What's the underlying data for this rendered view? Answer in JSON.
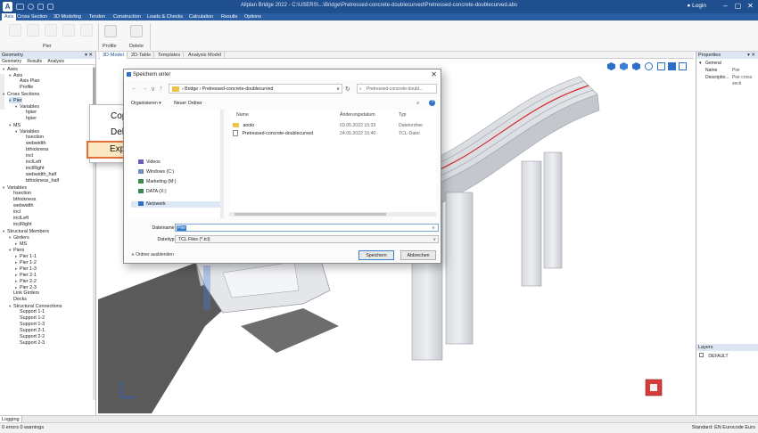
{
  "app": {
    "logo_text": "A",
    "window_title": "Allplan Bridge 2022 - C:\\USERS\\...\\Bridge\\Pretressed-concrete-doublecurved\\Pretressed-concrete-doublecurved.abs",
    "login_label": "Login",
    "window_buttons": [
      "–",
      "▢",
      "✕"
    ]
  },
  "menubar": {
    "items": [
      "Axis",
      "Cross Section",
      "3D Modeling",
      "Tendon",
      "Construction",
      "Loads & Checks",
      "Calculation",
      "Results",
      "Options"
    ],
    "active_index": 0
  },
  "ribbon": {
    "groups": [
      {
        "label": "Pier"
      },
      {
        "label": "Profile"
      },
      {
        "label": "Delete"
      }
    ]
  },
  "left_panel": {
    "title": "Geometry",
    "tabs": [
      "Geometry",
      "Results",
      "Analysis"
    ],
    "tree": [
      {
        "label": "Axes",
        "level": 0,
        "arrow": "▾"
      },
      {
        "label": "Axis",
        "level": 1,
        "arrow": "▾"
      },
      {
        "label": "Axis Plan",
        "level": 2,
        "arrow": ""
      },
      {
        "label": "Profile",
        "level": 2,
        "arrow": ""
      },
      {
        "label": "Cross Sections",
        "level": 0,
        "arrow": "▾"
      },
      {
        "label": "Pier",
        "level": 1,
        "arrow": "▾",
        "selected": true
      },
      {
        "label": "Variables",
        "level": 2,
        "arrow": "▾"
      },
      {
        "label": "hpier",
        "level": 3,
        "arrow": ""
      },
      {
        "label": "hpier",
        "level": 3,
        "arrow": ""
      },
      {
        "label": "MS",
        "level": 1,
        "arrow": "▾"
      },
      {
        "label": "Variables",
        "level": 2,
        "arrow": "▾"
      },
      {
        "label": "hsection",
        "level": 3,
        "arrow": ""
      },
      {
        "label": "webwidth",
        "level": 3,
        "arrow": ""
      },
      {
        "label": "bthickness",
        "level": 3,
        "arrow": ""
      },
      {
        "label": "incl",
        "level": 3,
        "arrow": ""
      },
      {
        "label": "inclLeft",
        "level": 3,
        "arrow": ""
      },
      {
        "label": "inclRight",
        "level": 3,
        "arrow": ""
      },
      {
        "label": "webwidth_half",
        "level": 3,
        "arrow": ""
      },
      {
        "label": "bthickness_half",
        "level": 3,
        "arrow": ""
      },
      {
        "label": "Variables",
        "level": 0,
        "arrow": "▾"
      },
      {
        "label": "hsection",
        "level": 1,
        "arrow": ""
      },
      {
        "label": "bthickness",
        "level": 1,
        "arrow": ""
      },
      {
        "label": "webwidth",
        "level": 1,
        "arrow": ""
      },
      {
        "label": "incl",
        "level": 1,
        "arrow": ""
      },
      {
        "label": "inclLeft",
        "level": 1,
        "arrow": ""
      },
      {
        "label": "inclRight",
        "level": 1,
        "arrow": ""
      },
      {
        "label": "Structural Members",
        "level": 0,
        "arrow": "▾"
      },
      {
        "label": "Girders",
        "level": 1,
        "arrow": "▾"
      },
      {
        "label": "MS",
        "level": 2,
        "arrow": "▸"
      },
      {
        "label": "Piers",
        "level": 1,
        "arrow": "▾"
      },
      {
        "label": "Pier 1-1",
        "level": 2,
        "arrow": "▸"
      },
      {
        "label": "Pier 1-2",
        "level": 2,
        "arrow": "▸"
      },
      {
        "label": "Pier 1-3",
        "level": 2,
        "arrow": "▸"
      },
      {
        "label": "Pier 2-1",
        "level": 2,
        "arrow": "▸"
      },
      {
        "label": "Pier 2-2",
        "level": 2,
        "arrow": "▸"
      },
      {
        "label": "Pier 2-3",
        "level": 2,
        "arrow": "▸"
      },
      {
        "label": "Link Girders",
        "level": 1,
        "arrow": ""
      },
      {
        "label": "Decks",
        "level": 1,
        "arrow": ""
      },
      {
        "label": "Structural Connections",
        "level": 1,
        "arrow": "▾"
      },
      {
        "label": "Support 1-1",
        "level": 2,
        "arrow": ""
      },
      {
        "label": "Support 1-2",
        "level": 2,
        "arrow": ""
      },
      {
        "label": "Support 1-3",
        "level": 2,
        "arrow": ""
      },
      {
        "label": "Support 2-1",
        "level": 2,
        "arrow": ""
      },
      {
        "label": "Support 2-2",
        "level": 2,
        "arrow": ""
      },
      {
        "label": "Support 2-3",
        "level": 2,
        "arrow": ""
      }
    ]
  },
  "center": {
    "tabs": [
      "3D-Model",
      "2D-Table",
      "Templates",
      "Analysis Model"
    ],
    "active_tab": 0
  },
  "context_menu": {
    "items": [
      "Copy",
      "Delete"
    ],
    "highlighted": "Export to TCL File"
  },
  "dialog": {
    "title": "Speichern unter",
    "close": "✕",
    "breadcrumb": [
      "Bridge",
      "Pretressed-concrete-doublecurved"
    ],
    "search_placeholder": "Pretressed-concrete-doubl...",
    "organize_label": "Organisieren ▾",
    "new_folder_label": "Neuer Ordner",
    "nav_items": [
      {
        "label": "Videos",
        "icon": "video"
      },
      {
        "label": "Windows (C:)",
        "icon": "drive"
      },
      {
        "label": "Marketing (M:)",
        "icon": "netdrive"
      },
      {
        "label": "DATA (X:)",
        "icon": "netdrive"
      },
      {
        "label": "Netzwerk",
        "icon": "network",
        "selected": true
      }
    ],
    "columns": [
      "Name",
      "Änderungsdatum",
      "Typ"
    ],
    "files": [
      {
        "name": "anolo",
        "date": "03.05.2022 15:33",
        "type": "Dateiordner",
        "icon": "folder"
      },
      {
        "name": "Pretressed-concrete-doublecurved",
        "date": "24.05.2022 15:40",
        "type": "TCL-Datei",
        "icon": "file"
      }
    ],
    "filename_label": "Dateiname:",
    "filename_value": "Pier",
    "filetype_label": "Dateityp:",
    "filetype_value": "TCL Files (*.tcl)",
    "hide_folders_label": "Ordner ausblenden",
    "save_button": "Speichern",
    "cancel_button": "Abbrechen"
  },
  "right_panel": {
    "title": "Properties",
    "section": "General",
    "props": [
      {
        "key": "Name",
        "value": "Pier"
      },
      {
        "key": "Descriptio...",
        "value": "Pier cross secti"
      }
    ],
    "layers_title": "Layers",
    "layers": [
      "DEFAULT"
    ]
  },
  "log": {
    "tab": "Logging",
    "status": "0 errors 0 warnings"
  },
  "status": {
    "right": "Standard: EN Eurocode Euro"
  },
  "colors": {
    "title_bar": "#1f4f8f",
    "menu_bar": "#2a5ea3",
    "highlight_border": "#e2703a",
    "highlight_fill": "#fbe7c2",
    "tendon": "#d42a2a"
  }
}
